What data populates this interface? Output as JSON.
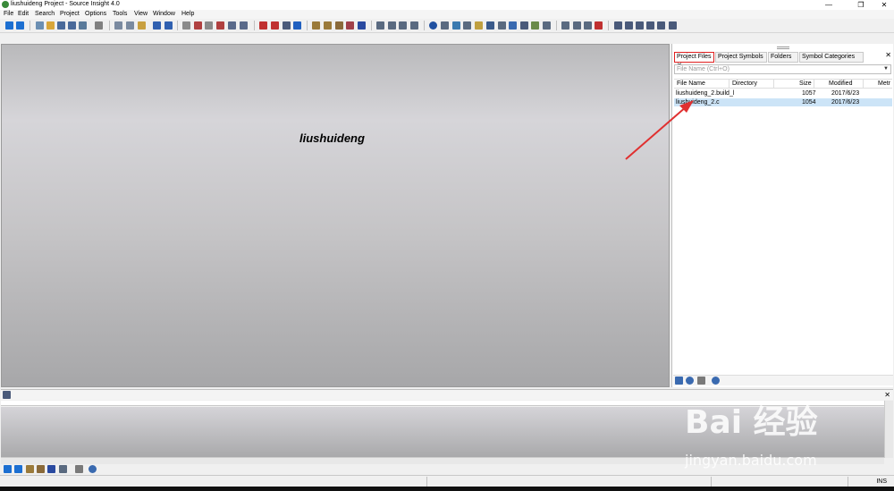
{
  "window": {
    "title": "liushuideng Project - Source Insight 4.0",
    "controls": [
      "—",
      "❐",
      "✕"
    ]
  },
  "menu": [
    "File",
    "Edit",
    "Search",
    "Project",
    "Options",
    "Tools",
    "View",
    "Window",
    "Help"
  ],
  "editor": {
    "title": "liushuideng"
  },
  "project_panel": {
    "tabs": [
      {
        "label": "Project Files",
        "active": true
      },
      {
        "label": "Project Symbols",
        "active": false
      },
      {
        "label": "Folders",
        "active": false
      },
      {
        "label": "Symbol Categories",
        "active": false
      }
    ],
    "search_placeholder": "File Name (Ctrl+O)",
    "columns": [
      "File Name",
      "Directory",
      "Size",
      "Modified",
      "Metr"
    ],
    "files": [
      {
        "name": "liushuideng_2.build_l",
        "directory": "",
        "size": "1057",
        "modified": "2017/6/23",
        "selected": false
      },
      {
        "name": "liushuideng_2.c",
        "directory": "",
        "size": "1054",
        "modified": "2017/6/23",
        "selected": true
      }
    ]
  },
  "status": {
    "mode": "INS"
  },
  "watermark": {
    "main": "Bai 经验",
    "url": "jingyan.baidu.com"
  },
  "colors": {
    "highlight_box": "#e02020",
    "arrow": "#e03030",
    "selected_row": "#cce4f7"
  }
}
